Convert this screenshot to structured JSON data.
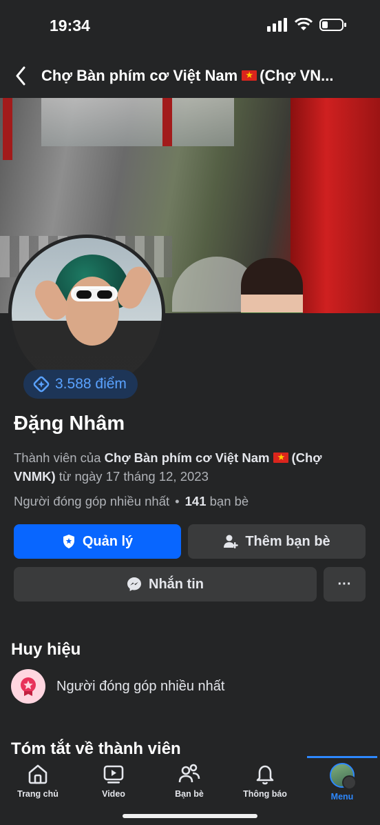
{
  "status_bar": {
    "time": "19:34"
  },
  "nav": {
    "title": "Chợ Bàn phím cơ Việt Nam",
    "title_suffix": "(Chợ VN...",
    "flag_icon": "vietnam-flag-icon"
  },
  "profile": {
    "points": "3.588 điểm",
    "name": "Đặng Nhâm",
    "member_prefix": "Thành viên của",
    "group_name": "Chợ Bàn phím cơ Việt Nam",
    "group_suffix": "(Chợ VNMK)",
    "member_since": "từ ngày 17 tháng 12, 2023",
    "role": "Người đóng góp nhiều nhất",
    "separator": "•",
    "friends_count": "141",
    "friends_label": "bạn bè"
  },
  "actions": {
    "manage": "Quản lý",
    "add_friend": "Thêm bạn bè",
    "message": "Nhắn tin",
    "more": "···"
  },
  "badges": {
    "title": "Huy hiệu",
    "items": [
      {
        "label": "Người đóng góp nhiều nhất",
        "icon": "star-medal-icon"
      }
    ]
  },
  "summary": {
    "title": "Tóm tắt về thành viên"
  },
  "tabbar": {
    "items": [
      {
        "label": "Trang chủ",
        "icon": "home-icon"
      },
      {
        "label": "Video",
        "icon": "video-icon"
      },
      {
        "label": "Bạn bè",
        "icon": "friends-icon"
      },
      {
        "label": "Thông báo",
        "icon": "bell-icon"
      },
      {
        "label": "Menu",
        "icon": "menu-avatar-icon",
        "active": true
      }
    ]
  },
  "colors": {
    "background": "#242526",
    "accent": "#0866ff",
    "active_tab": "#2d88ff",
    "secondary_text": "#b0b3b8"
  }
}
